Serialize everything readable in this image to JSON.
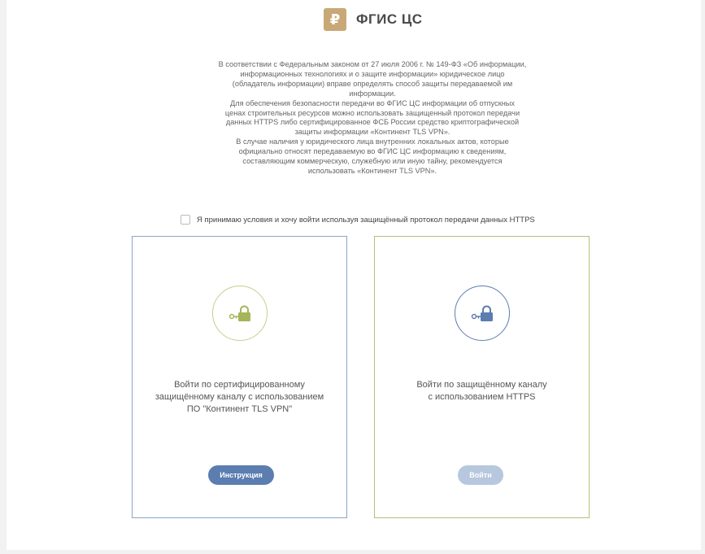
{
  "header": {
    "logo_glyph": "₽",
    "title": "ФГИС ЦС"
  },
  "intro": {
    "lines": [
      "В соответствии с Федеральным законом от 27 июля 2006 г. № 149-ФЗ «Об информации,",
      "информационных технологиях и о защите информации» юридическое лицо",
      "(обладатель информации) вправе определять способ защиты передаваемой им",
      "информации.",
      "Для обеспечения безопасности передачи во ФГИС ЦС информации об отпускных",
      "ценах строительных ресурсов можно использовать защищенный протокол передачи",
      "данных HTTPS либо сертифицированное ФСБ России средство криптографической",
      "защиты информации «Континент TLS VPN».",
      "В случае наличия у юридического лица внутренних локальных актов, которые",
      "официально относят передаваемую во ФГИС ЦС информацию к сведениям,",
      "составляющим коммерческую, служебную или иную тайну, рекомендуется",
      "использовать «Континент TLS VPN»."
    ]
  },
  "agree": {
    "label": "Я принимаю условия и хочу войти используя защищённый протокол передачи данных HTTPS",
    "checked": false
  },
  "card_vpn": {
    "lines": [
      "Войти по сертифицированному",
      "защищённому каналу с использованием",
      "ПО \"Континент TLS VPN\""
    ],
    "button_label": "Инструкция",
    "accent": "#c5cf8a",
    "lock_color": "#a6b55a"
  },
  "card_https": {
    "lines": [
      "Войти по защищённому каналу",
      "с использованием HTTPS"
    ],
    "button_label": "Войти",
    "accent": "#5b7db0",
    "lock_color": "#5b7db0"
  },
  "icons": {
    "logo": "ruble-logo-icon",
    "vpn_lock": "lock-key-icon",
    "https_lock": "lock-key-icon"
  }
}
